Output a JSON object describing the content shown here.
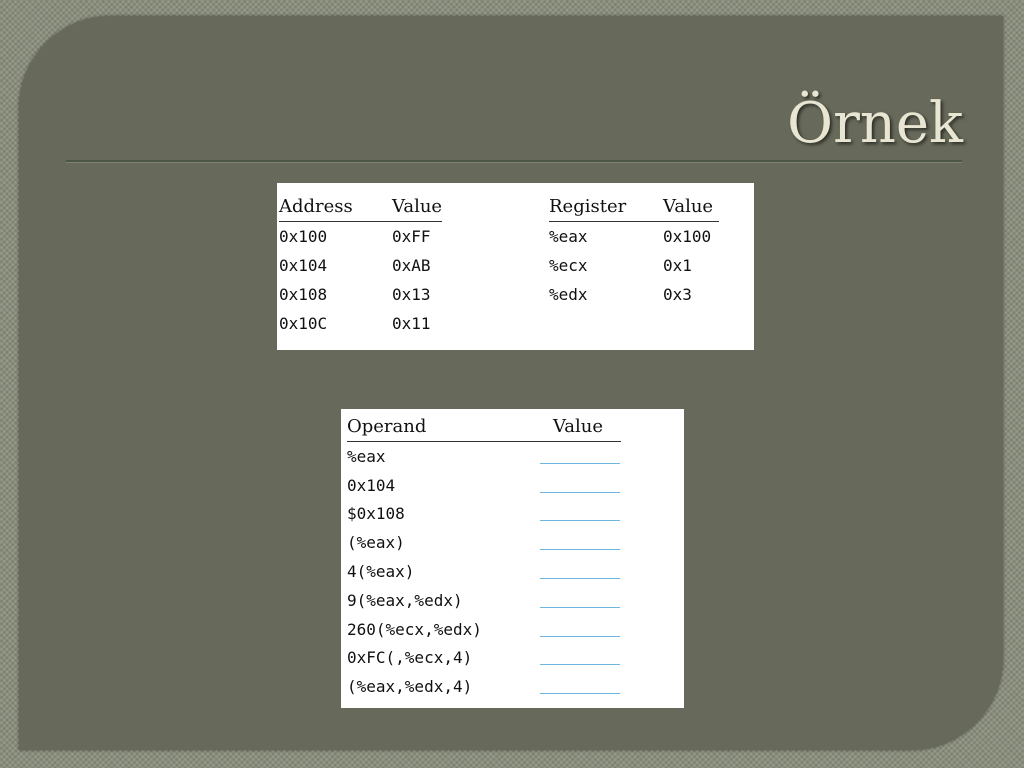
{
  "slide": {
    "title": "Örnek"
  },
  "memory_table": {
    "headers": [
      "Address",
      "Value"
    ],
    "rows": [
      [
        "0x100",
        "0xFF"
      ],
      [
        "0x104",
        "0xAB"
      ],
      [
        "0x108",
        "0x13"
      ],
      [
        "0x10C",
        "0x11"
      ]
    ]
  },
  "register_table": {
    "headers": [
      "Register",
      "Value"
    ],
    "rows": [
      [
        "%eax",
        "0x100"
      ],
      [
        "%ecx",
        "0x1"
      ],
      [
        "%edx",
        "0x3"
      ]
    ]
  },
  "operand_table": {
    "headers": [
      "Operand",
      "Value"
    ],
    "rows": [
      [
        "%eax",
        ""
      ],
      [
        "0x104",
        ""
      ],
      [
        "$0x108",
        ""
      ],
      [
        "(%eax)",
        ""
      ],
      [
        "4(%eax)",
        ""
      ],
      [
        "9(%eax,%edx)",
        ""
      ],
      [
        "260(%ecx,%edx)",
        ""
      ],
      [
        "0xFC(,%ecx,4)",
        ""
      ],
      [
        "(%eax,%edx,4)",
        ""
      ]
    ]
  },
  "colors": {
    "slide_background": "#676a5b",
    "title_text": "#e8e6d2",
    "answer_blank_line": "#6fb6df"
  }
}
